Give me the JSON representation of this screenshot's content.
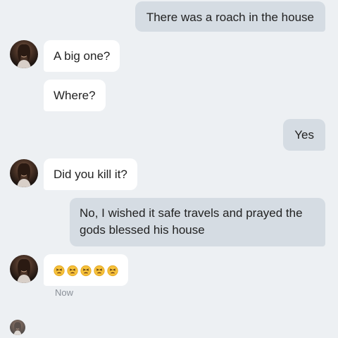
{
  "conversation": {
    "messages": [
      {
        "side": "sent",
        "text": "There was a roach in the house"
      },
      {
        "side": "received",
        "text": "A big one?"
      },
      {
        "side": "received",
        "text": "Where?"
      },
      {
        "side": "sent",
        "text": "Yes"
      },
      {
        "side": "received",
        "text": "Did you kill it?"
      },
      {
        "side": "sent",
        "text": "No, I wished it safe travels and prayed the gods blessed his house"
      },
      {
        "side": "received",
        "emoji": [
          "😣",
          "😣",
          "😣",
          "😣",
          "😣"
        ]
      }
    ],
    "timestamp": "Now",
    "emoji_icon": "persevering-face-icon",
    "colors": {
      "background": "#edf0f3",
      "sent_bubble": "#d5dce3",
      "received_bubble": "#ffffff",
      "timestamp": "#8a9098"
    }
  }
}
